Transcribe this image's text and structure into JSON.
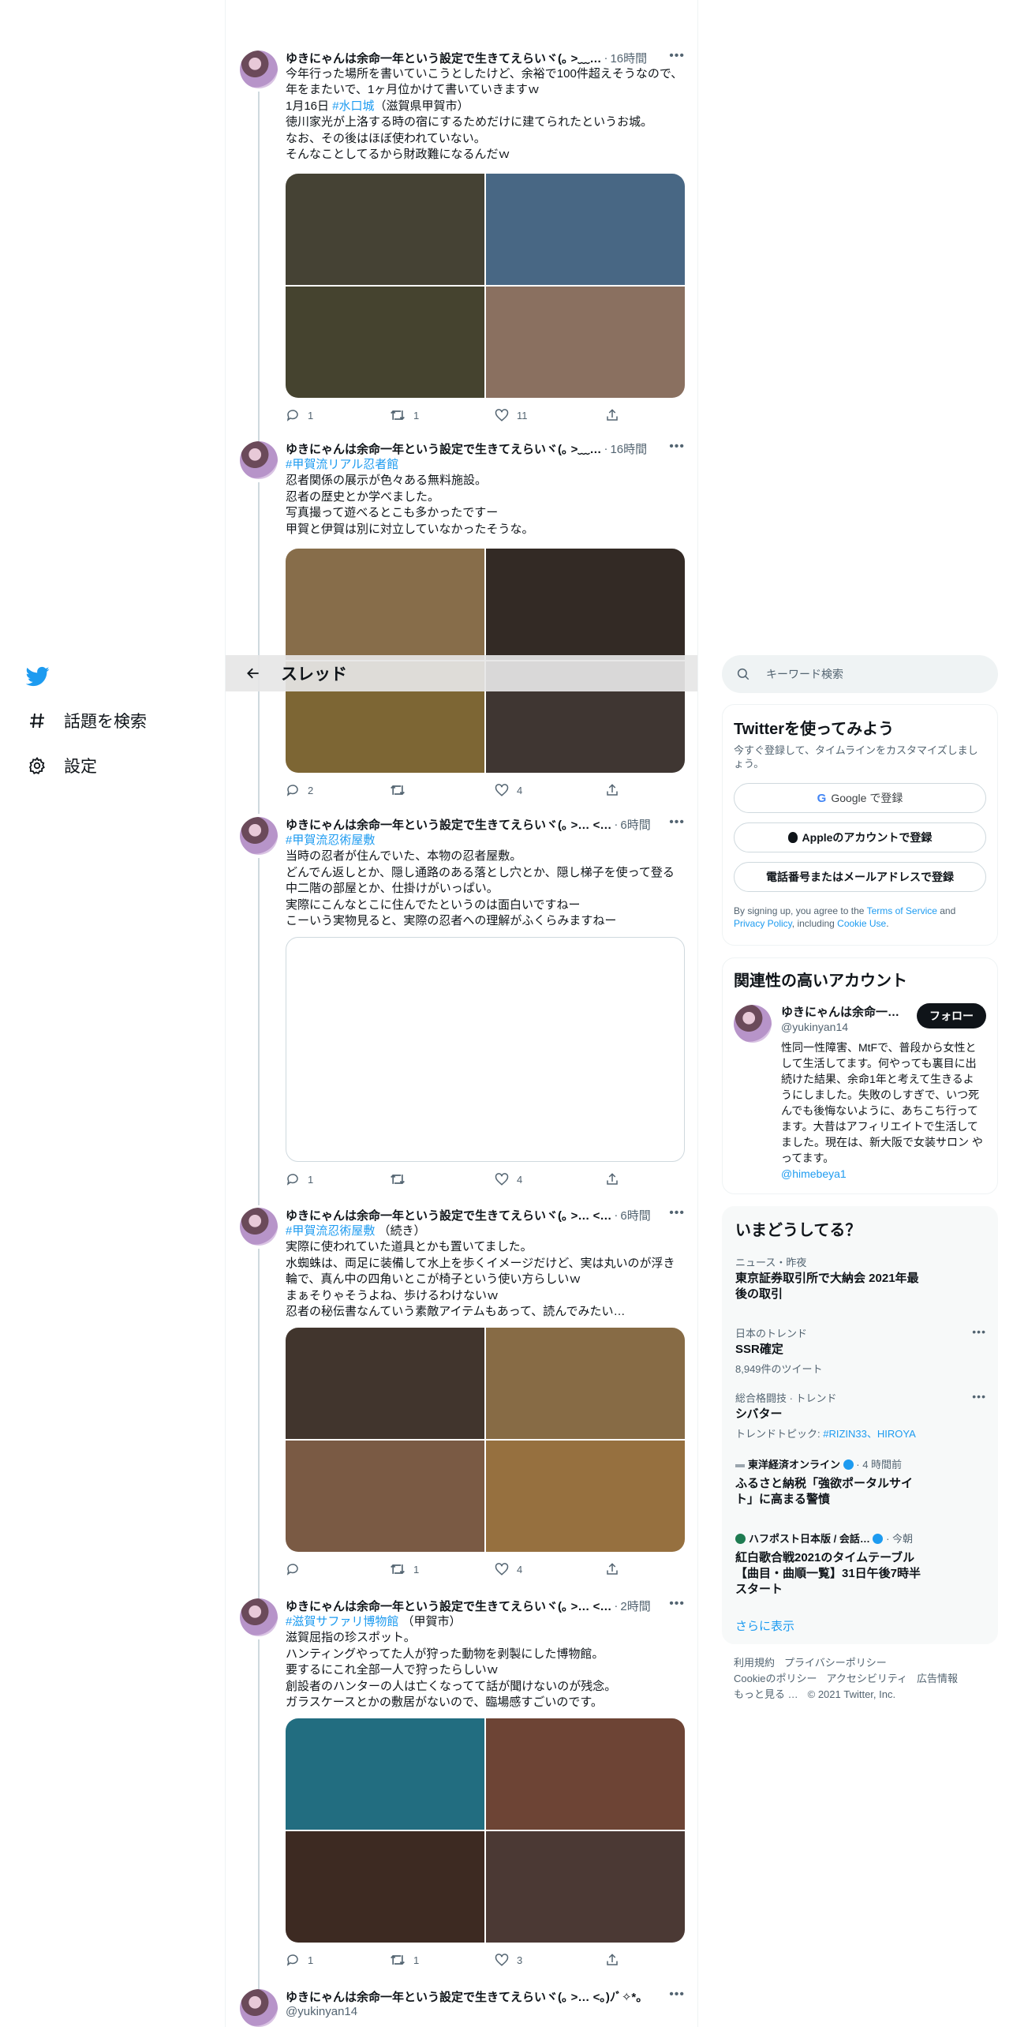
{
  "nav": {
    "explore_label": "話題を検索",
    "settings_label": "設定"
  },
  "header": {
    "title": "スレッド"
  },
  "search": {
    "placeholder": "キーワード検索"
  },
  "tweets": [
    {
      "name": "ゆきにゃんは余命一年という設定で生きてえらいヾ(｡ >﹏…",
      "time": "16時間",
      "lines": [
        "今年行った場所を書いていこうとしたけど、余裕で100件超えそうなので、",
        "年をまたいで、1ヶ月位かけて書いていきますｗ"
      ],
      "line3_pre": "1月16日 ",
      "line3_tag": "#水口城",
      "line3_post": "（滋賀県甲賀市）",
      "lines2": [
        "徳川家光が上洛する時の宿にするためだけに建てられたというお城。",
        "なお、その後はほぼ使われていない。",
        "そんなことしてるから財政難になるんだｗ"
      ],
      "reply": "1",
      "retweet": "1",
      "like": "11",
      "colors": [
        "#454234",
        "#486784",
        "#45432f",
        "#8a7060"
      ]
    },
    {
      "name": "ゆきにゃんは余命一年という設定で生きてえらいヾ(｡ >﹏…",
      "time": "16時間",
      "tag": "#甲賀流リアル忍者館",
      "lines": [
        "忍者関係の展示が色々ある無料施設。",
        "忍者の歴史とか学べました。",
        "写真撮って遊べるとこも多かったですー",
        "甲賀と伊賀は別に対立していなかったそうな。"
      ],
      "reply": "2",
      "retweet": "",
      "like": "4",
      "colors": [
        "#876d4a",
        "#332a25",
        "#7d6634",
        "#3f3632"
      ]
    },
    {
      "name": "ゆきにゃんは余命一年という設定で生きてえらいヾ(｡ >… <…",
      "time": "6時間",
      "tag": "#甲賀流忍術屋敷",
      "lines": [
        "当時の忍者が住んでいた、本物の忍者屋敷。",
        "どんでん返しとか、隠し通路のある落とし穴とか、隠し梯子を使って登る",
        "中二階の部屋とか、仕掛けがいっぱい。",
        "実際にこんなとこに住んでたというのは面白いですねー",
        "こーいう実物見ると、実際の忍者への理解がふくらみますねー"
      ],
      "reply": "1",
      "retweet": "",
      "like": "4"
    },
    {
      "name": "ゆきにゃんは余命一年という設定で生きてえらいヾ(｡ >… <…",
      "time": "6時間",
      "tag": "#甲賀流忍術屋敷",
      "tag_post": "（続き）",
      "lines": [
        "実際に使われていた道具とかも置いてました。",
        "水蜘蛛は、両足に装備して水上を歩くイメージだけど、実は丸いのが浮き",
        "輪で、真ん中の四角いとこが椅子という使い方らしいｗ",
        "まぁそりゃそうよね、歩けるわけないｗ",
        "忍者の秘伝書なんていう素敵アイテムもあって、読んでみたい…"
      ],
      "reply": "",
      "retweet": "1",
      "like": "4",
      "colors": [
        "#41352d",
        "#876b45",
        "#7a5a44",
        "#96703f"
      ]
    },
    {
      "name": "ゆきにゃんは余命一年という設定で生きてえらいヾ(｡ >… <…",
      "time": "2時間",
      "tag": "#滋賀サファリ博物館",
      "tag_post": "（甲賀市）",
      "lines": [
        "滋賀屈指の珍スポット。",
        "ハンティングやってた人が狩った動物を剥製にした博物館。",
        "要するにこれ全部一人で狩ったらしいｗ",
        "創設者のハンターの人は亡くなってて話が聞けないのが残念。",
        "ガラスケースとかの敷居がないので、臨場感すごいのです。"
      ],
      "reply": "1",
      "retweet": "1",
      "like": "3",
      "colors": [
        "#226d80",
        "#6d4435",
        "#3d2a22",
        "#4b3934"
      ]
    },
    {
      "name": "ゆきにゃんは余命一年という設定で生きてえらいヾ(｡ >… <｡)ﾉﾞ✧*。",
      "handle": "@yukinyan14"
    }
  ],
  "signup": {
    "title": "Twitterを使ってみよう",
    "subtitle": "今すぐ登録して、タイムラインをカスタマイズしましょう。",
    "google": "Google で登録",
    "apple": "Appleのアカウントで登録",
    "phone": "電話番号またはメールアドレスで登録",
    "legal_pre": "By signing up, you agree to the ",
    "tos": "Terms of Service",
    "legal_and": " and ",
    "privacy": "Privacy Policy",
    "legal_inc": ", including ",
    "cookie": "Cookie Use",
    "legal_end": "."
  },
  "related": {
    "title": "関連性の高いアカウント",
    "name": "ゆきにゃんは余命一…",
    "handle": "@yukinyan14",
    "follow": "フォロー",
    "bio": "性同一性障害、MtFで、普段から女性として生活してます。何やっても裏目に出続けた結果、余命1年と考えて生きるようにしました。失敗のしすぎで、いつ死んでも後悔ないように、あちこち行ってます。大昔はアフィリエイトで生活してました。現在は、新大阪で女装サロン やってます。",
    "bio_link": "@himebeya1"
  },
  "trends": {
    "title": "いまどうしてる？",
    "items": [
      {
        "meta": "ニュース・昨夜",
        "title": "東京証券取引所で大納会 2021年最後の取引"
      },
      {
        "meta": "日本のトレンド",
        "title": "SSR確定",
        "count": "8,949件のツイート"
      },
      {
        "meta": "総合格闘技 · トレンド",
        "title": "シバター",
        "count_pre": "トレンドトピック: ",
        "count_tags": "#RIZIN33、HIROYA"
      },
      {
        "meta": "東洋経済オンライン",
        "meta_time": "· 4 時間前",
        "title": "ふるさと納税「強欲ポータルサイト」に高まる警憤"
      },
      {
        "meta": "ハフポスト日本版 / 会話…",
        "meta_time": "· 今朝",
        "title": "紅白歌合戦2021のタイムテーブル【曲目・曲順一覧】31日午後7時半スタート"
      }
    ],
    "show_more": "さらに表示"
  },
  "footer": {
    "terms": "利用規約",
    "privacy": "プライバシーポリシー",
    "cookie": "Cookieのポリシー",
    "accessibility": "アクセシビリティ",
    "ads": "広告情報",
    "more": "もっと見る …",
    "copyright": "© 2021 Twitter, Inc."
  },
  "colors": {
    "accent": "#1d9bf0",
    "text": "#0f1419",
    "muted": "#536471"
  }
}
